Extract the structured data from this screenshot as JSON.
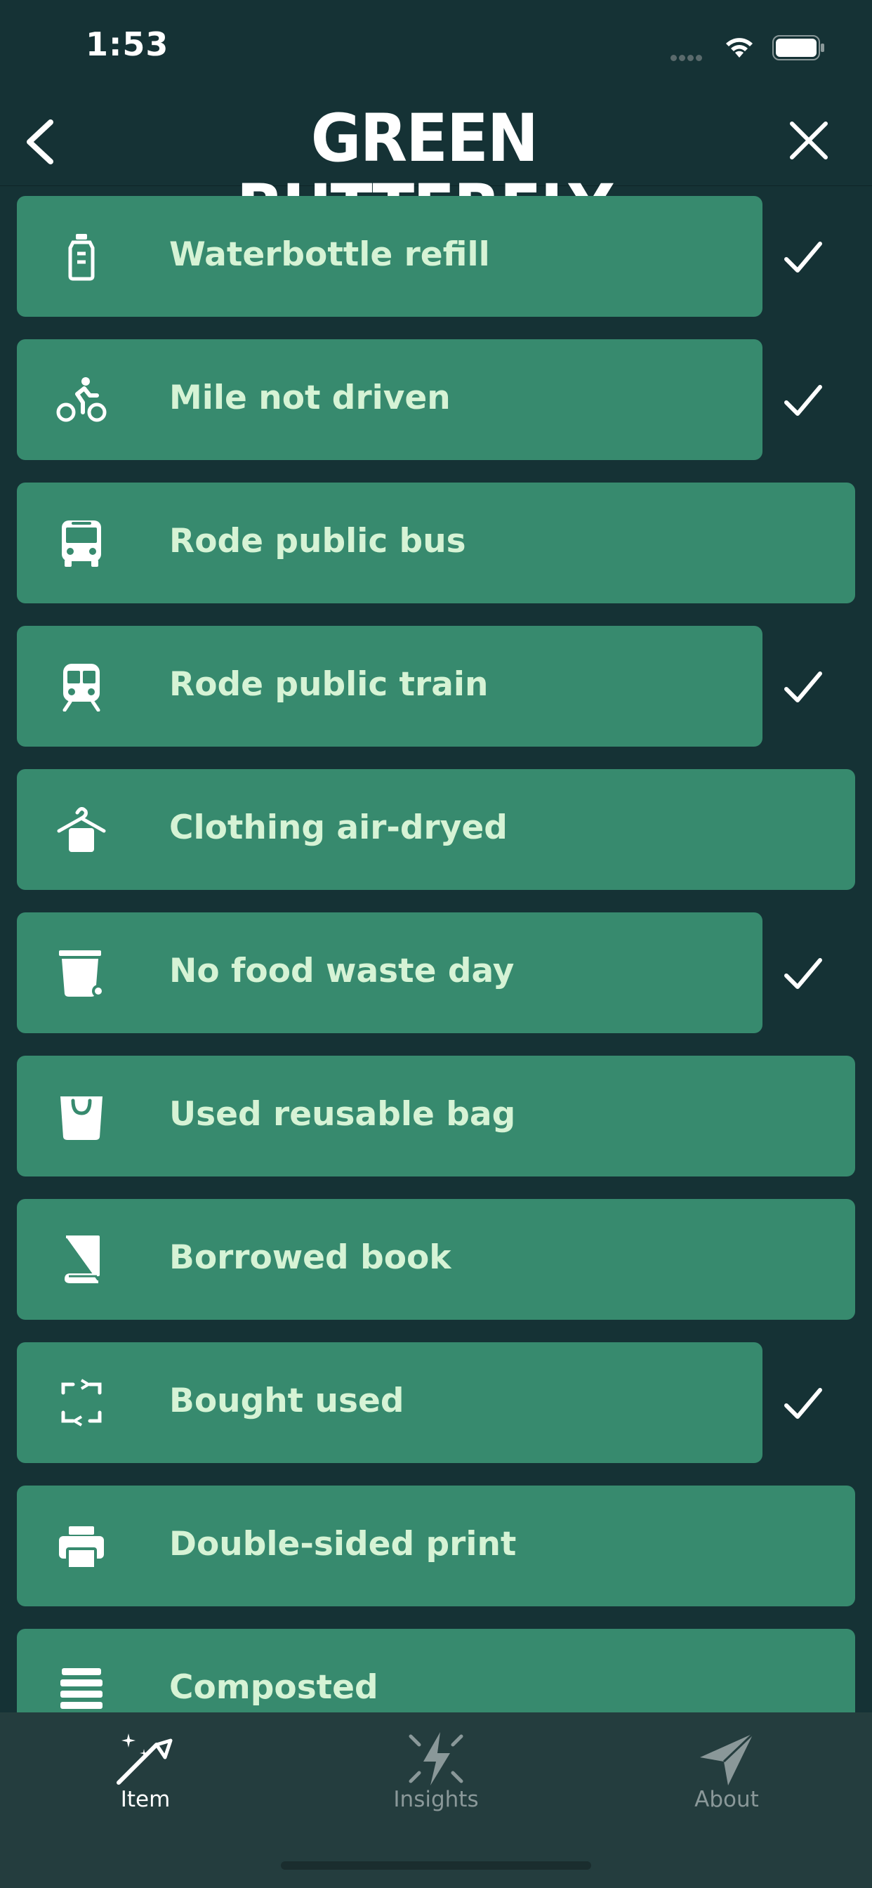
{
  "status": {
    "time": "1:53"
  },
  "nav": {
    "title": "GREEN BUTTERFLY"
  },
  "items": [
    {
      "label": "Waterbottle refill",
      "checked": true
    },
    {
      "label": "Mile not driven",
      "checked": true
    },
    {
      "label": "Rode public bus",
      "checked": false
    },
    {
      "label": "Rode public train",
      "checked": true
    },
    {
      "label": "Clothing air-dryed",
      "checked": false
    },
    {
      "label": "No food waste day",
      "checked": true
    },
    {
      "label": "Used reusable bag",
      "checked": false
    },
    {
      "label": "Borrowed book",
      "checked": false
    },
    {
      "label": "Bought used",
      "checked": true
    },
    {
      "label": "Double-sided print",
      "checked": false
    },
    {
      "label": "Composted",
      "checked": false
    }
  ],
  "tabs": [
    {
      "label": "Item",
      "selected": true
    },
    {
      "label": "Insights",
      "selected": false
    },
    {
      "label": "About",
      "selected": false
    }
  ],
  "colors": {
    "background": "#153235",
    "row": "#378a6e",
    "row_text": "#d6f3d5",
    "tabbar": "#243d3e",
    "tab_inactive": "#8a9899"
  }
}
